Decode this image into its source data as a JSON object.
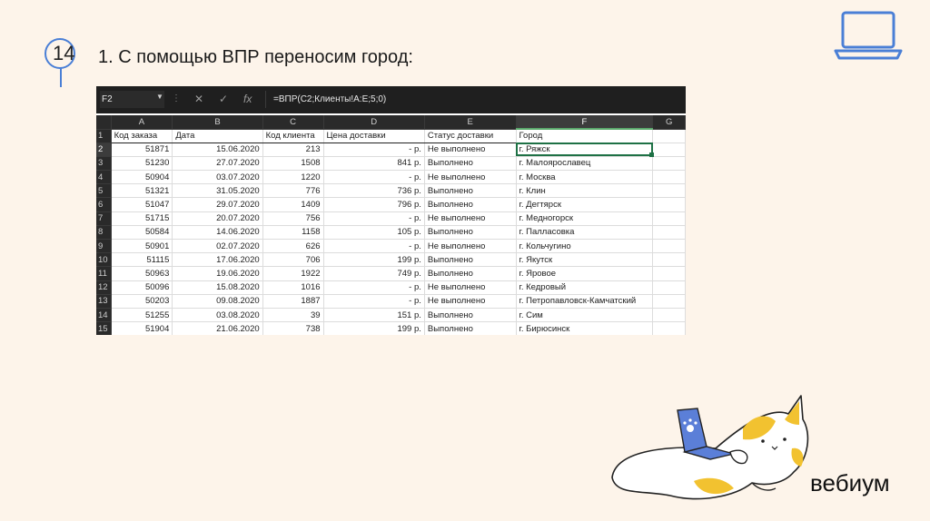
{
  "slide": {
    "number": "14",
    "title": "1. С помощью ВПР переносим город:",
    "brand": "вебиум"
  },
  "colors": {
    "accent": "#4a7fd6",
    "excel_green": "#1e7145",
    "background": "#fdf4ea"
  },
  "excel": {
    "name_box": "F2",
    "formula": "=ВПР(C2;Клиенты!A:E;5;0)",
    "columns": [
      "A",
      "B",
      "C",
      "D",
      "E",
      "F",
      "G"
    ],
    "headers": [
      "Код заказа",
      "Дата",
      "Код клиента",
      "Цена доставки",
      "Статус доставки",
      "Город",
      ""
    ],
    "rows": [
      {
        "n": "2",
        "a": "51871",
        "b": "15.06.2020",
        "c": "213",
        "d": "-   р.",
        "e": "Не выполнено",
        "f": "г. Ряжск"
      },
      {
        "n": "3",
        "a": "51230",
        "b": "27.07.2020",
        "c": "1508",
        "d": "841 р.",
        "e": "Выполнено",
        "f": "г. Малоярославец"
      },
      {
        "n": "4",
        "a": "50904",
        "b": "03.07.2020",
        "c": "1220",
        "d": "-   р.",
        "e": "Не выполнено",
        "f": "г. Москва"
      },
      {
        "n": "5",
        "a": "51321",
        "b": "31.05.2020",
        "c": "776",
        "d": "736 р.",
        "e": "Выполнено",
        "f": "г. Клин"
      },
      {
        "n": "6",
        "a": "51047",
        "b": "29.07.2020",
        "c": "1409",
        "d": "796 р.",
        "e": "Выполнено",
        "f": "г. Дегтярск"
      },
      {
        "n": "7",
        "a": "51715",
        "b": "20.07.2020",
        "c": "756",
        "d": "-   р.",
        "e": "Не выполнено",
        "f": "г. Медногорск"
      },
      {
        "n": "8",
        "a": "50584",
        "b": "14.06.2020",
        "c": "1158",
        "d": "105 р.",
        "e": "Выполнено",
        "f": "г. Палласовка"
      },
      {
        "n": "9",
        "a": "50901",
        "b": "02.07.2020",
        "c": "626",
        "d": "-   р.",
        "e": "Не выполнено",
        "f": "г. Кольчугино"
      },
      {
        "n": "10",
        "a": "51115",
        "b": "17.06.2020",
        "c": "706",
        "d": "199 р.",
        "e": "Выполнено",
        "f": "г. Якутск"
      },
      {
        "n": "11",
        "a": "50963",
        "b": "19.06.2020",
        "c": "1922",
        "d": "749 р.",
        "e": "Выполнено",
        "f": "г. Яровое"
      },
      {
        "n": "12",
        "a": "50096",
        "b": "15.08.2020",
        "c": "1016",
        "d": "-   р.",
        "e": "Не выполнено",
        "f": "г. Кедровый"
      },
      {
        "n": "13",
        "a": "50203",
        "b": "09.08.2020",
        "c": "1887",
        "d": "-   р.",
        "e": "Не выполнено",
        "f": "г. Петропавловск-Камчатский"
      },
      {
        "n": "14",
        "a": "51255",
        "b": "03.08.2020",
        "c": "39",
        "d": "151 р.",
        "e": "Выполнено",
        "f": "г. Сим"
      },
      {
        "n": "15",
        "a": "51904",
        "b": "21.06.2020",
        "c": "738",
        "d": "199 р.",
        "e": "Выполнено",
        "f": "г. Бирюсинск"
      }
    ]
  }
}
